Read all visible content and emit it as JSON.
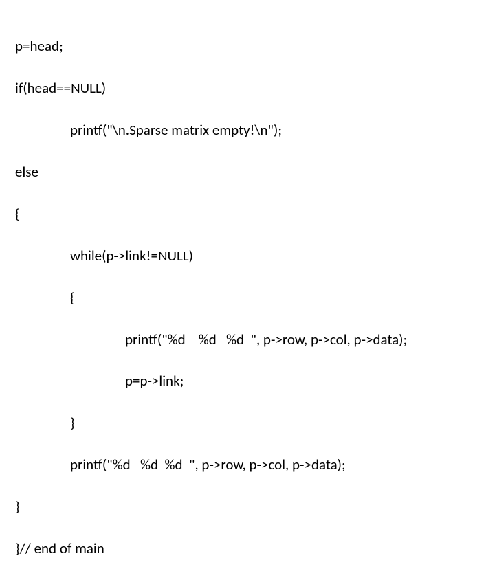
{
  "code": {
    "l1": "p=head;",
    "l2": "if(head==NULL)",
    "l3": "printf(\"\\n.Sparse matrix empty!\\n\");",
    "l4": "else",
    "l5": "{",
    "l6": "while(p->link!=NULL)",
    "l7": "{",
    "l8": "printf(\"%d    %d   %d  \", p->row, p->col, p->data);",
    "l9": "p=p->link;",
    "l10": "}",
    "l11": "printf(\"%d   %d  %d  \", p->row, p->col, p->data);",
    "l12": "}",
    "l13": "}// end of main"
  }
}
